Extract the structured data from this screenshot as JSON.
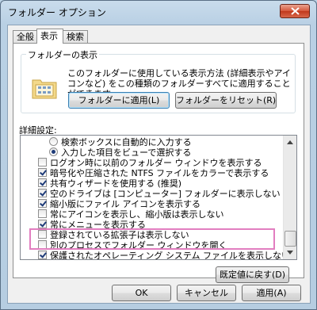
{
  "window": {
    "title": "フォルダー オプション"
  },
  "tabs": [
    {
      "label": "全般"
    },
    {
      "label": "表示"
    },
    {
      "label": "検索"
    }
  ],
  "folder_view": {
    "group_label": "フォルダーの表示",
    "description": "このフォルダーに使用している表示方法 (詳細表示やアイコンなど) をこの種類のフォルダーすべてに適用することができます。",
    "apply_label": "フォルダーに適用(L)",
    "reset_label": "フォルダーをリセット(R)"
  },
  "advanced": {
    "label": "詳細設定:",
    "items": [
      {
        "type": "radio",
        "checked": false,
        "label": "検索ボックスに自動的に入力する"
      },
      {
        "type": "radio",
        "checked": true,
        "label": "入力した項目をビューで選択する"
      },
      {
        "type": "checkbox",
        "checked": false,
        "label": "ログオン時に以前のフォルダー ウィンドウを表示する"
      },
      {
        "type": "checkbox",
        "checked": true,
        "label": "暗号化や圧縮された NTFS ファイルをカラーで表示する"
      },
      {
        "type": "checkbox",
        "checked": true,
        "label": "共有ウィザードを使用する (推奨)"
      },
      {
        "type": "checkbox",
        "checked": true,
        "label": "空のドライブは [コンピューター] フォルダーに表示しない"
      },
      {
        "type": "checkbox",
        "checked": true,
        "label": "縮小版にファイル アイコンを表示する"
      },
      {
        "type": "checkbox",
        "checked": false,
        "label": "常にアイコンを表示し、縮小版は表示しない"
      },
      {
        "type": "checkbox",
        "checked": true,
        "label": "常にメニューを表示する"
      },
      {
        "type": "checkbox",
        "checked": false,
        "label": "登録されている拡張子は表示しない"
      },
      {
        "type": "checkbox",
        "checked": false,
        "label": "別のプロセスでフォルダー ウィンドウを開く"
      },
      {
        "type": "checkbox",
        "checked": true,
        "label": "保護されたオペレーティング システム ファイルを表示しない (推奨)"
      }
    ],
    "restore_label": "既定値に戻す(D)"
  },
  "footer": {
    "ok_label": "OK",
    "cancel_label": "キャンセル",
    "apply_label": "適用(A)"
  },
  "colors": {
    "highlight": "#e27ec0"
  }
}
